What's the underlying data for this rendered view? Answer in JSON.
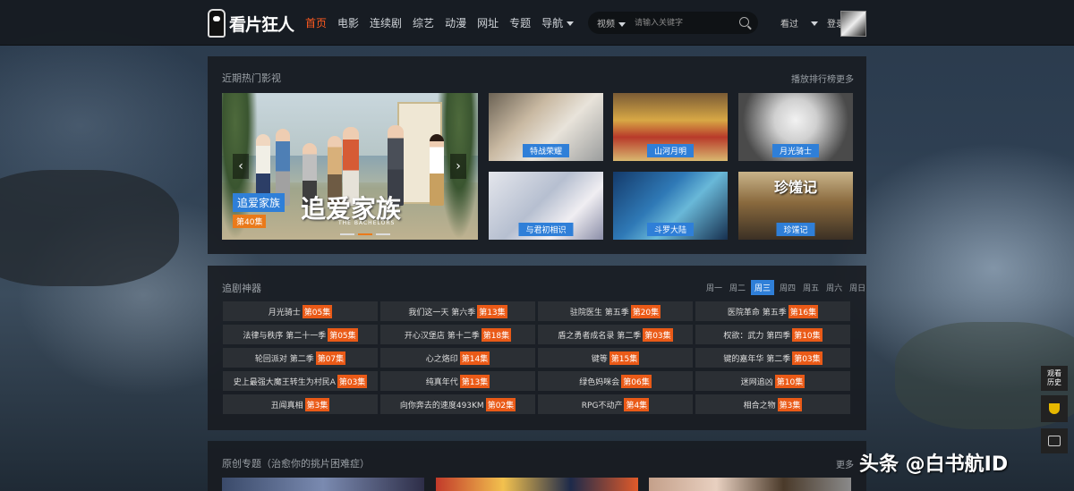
{
  "header": {
    "logo_text": "看片狂人",
    "nav": [
      {
        "label": "首页",
        "active": true
      },
      {
        "label": "电影"
      },
      {
        "label": "连续剧"
      },
      {
        "label": "综艺"
      },
      {
        "label": "动漫"
      },
      {
        "label": "网址"
      },
      {
        "label": "专题"
      },
      {
        "label": "导航"
      }
    ],
    "search_type": "视频",
    "search_placeholder": "请输入关键字",
    "history_label": "看过",
    "login_label": "登录"
  },
  "hot": {
    "title": "近期热门影视",
    "rank_link": "播放排行榜",
    "more_link": "更多",
    "featured": {
      "title": "追爱家族",
      "episode": "第40集",
      "art_title": "追爱家族",
      "art_subtitle": "THE BACHELORS"
    },
    "thumbs": [
      {
        "label": "特战荣耀"
      },
      {
        "label": "山河月明"
      },
      {
        "label": "月光骑士"
      },
      {
        "label": "与君初相识"
      },
      {
        "label": "斗罗大陆"
      },
      {
        "label": "珍馐记",
        "art_title": "珍馐记"
      }
    ],
    "carousel_dots": 3,
    "carousel_active": 1
  },
  "schedule": {
    "title": "追剧神器",
    "days": [
      "周一",
      "周二",
      "周三",
      "周四",
      "周五",
      "周六",
      "周日"
    ],
    "active_day": "周三",
    "items": [
      {
        "name": "月光骑士",
        "ep": "第05集"
      },
      {
        "name": "我们这一天 第六季",
        "ep": "第13集"
      },
      {
        "name": "驻院医生 第五季",
        "ep": "第20集"
      },
      {
        "name": "医院革命 第五季",
        "ep": "第16集"
      },
      {
        "name": "法律与秩序 第二十一季",
        "ep": "第05集"
      },
      {
        "name": "开心汉堡店 第十二季",
        "ep": "第18集"
      },
      {
        "name": "盾之勇者成名录 第二季",
        "ep": "第03集"
      },
      {
        "name": "权欲：武力 第四季",
        "ep": "第10集"
      },
      {
        "name": "轮回派对 第二季",
        "ep": "第07集"
      },
      {
        "name": "心之烙印",
        "ep": "第14集"
      },
      {
        "name": "键等",
        "ep": "第15集"
      },
      {
        "name": "键的嘉年华 第二季",
        "ep": "第03集"
      },
      {
        "name": "史上最强大魔王转生为村民A",
        "ep": "第03集"
      },
      {
        "name": "纯真年代",
        "ep": "第13集"
      },
      {
        "name": "绿色妈咪会",
        "ep": "第06集"
      },
      {
        "name": "迷网追凶",
        "ep": "第10集"
      },
      {
        "name": "丑闻真相",
        "ep": "第3集"
      },
      {
        "name": "向你奔去的速度493KM",
        "ep": "第02集"
      },
      {
        "name": "RPG不动产",
        "ep": "第4集"
      },
      {
        "name": "相合之物",
        "ep": "第3集"
      }
    ]
  },
  "original": {
    "title": "原创专题（治愈你的挑片困难症）",
    "more_link": "更多"
  },
  "side": {
    "history_label_1": "观看",
    "history_label_2": "历史"
  },
  "watermark": "头条 @白书航ID",
  "colors": {
    "accent_orange": "#ea5a17",
    "accent_blue": "#2f7fd8",
    "active_nav": "#ff5a1f"
  }
}
